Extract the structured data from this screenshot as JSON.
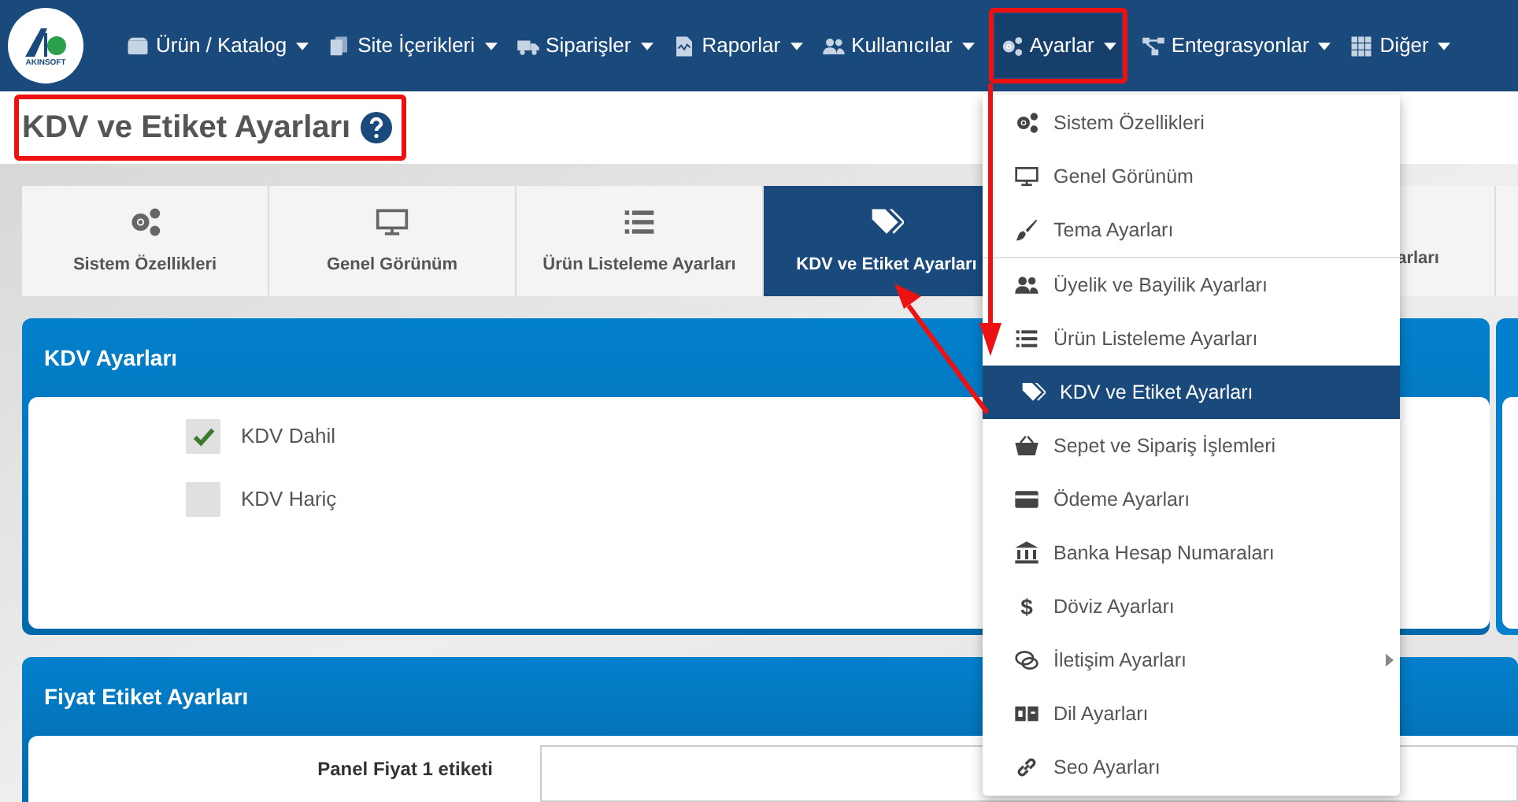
{
  "logo": {
    "text": "AKINSOFT"
  },
  "nav": [
    {
      "label": "Ürün / Katalog",
      "selected": false
    },
    {
      "label": "Site İçerikleri",
      "selected": false
    },
    {
      "label": "Siparişler",
      "selected": false
    },
    {
      "label": "Raporlar",
      "selected": false
    },
    {
      "label": "Kullanıcılar",
      "selected": false
    },
    {
      "label": "Ayarlar",
      "selected": true
    },
    {
      "label": "Entegrasyonlar",
      "selected": false
    },
    {
      "label": "Diğer",
      "selected": false
    }
  ],
  "page_title": "KDV ve Etiket Ayarları",
  "tabs": [
    {
      "label": "Sistem Özellikleri",
      "selected": false
    },
    {
      "label": "Genel Görünüm",
      "selected": false
    },
    {
      "label": "Ürün Listeleme Ayarları",
      "selected": false
    },
    {
      "label": "KDV ve Etiket Ayarları",
      "selected": true
    },
    {
      "label": "arları",
      "selected": false
    }
  ],
  "kdv_panel": {
    "title": "KDV Ayarları",
    "options": [
      {
        "label": "KDV Dahil",
        "checked": true
      },
      {
        "label": "KDV Hariç",
        "checked": false
      }
    ]
  },
  "price_panel": {
    "title": "Fiyat Etiket Ayarları",
    "fields": [
      {
        "label": "Panel Fiyat 1 etiketi"
      }
    ]
  },
  "menu": {
    "items": [
      {
        "label": "Sistem Özellikleri",
        "selected": false
      },
      {
        "label": "Genel Görünüm",
        "selected": false
      },
      {
        "label": "Tema Ayarları",
        "selected": false
      },
      {
        "label": "Üyelik ve Bayilik Ayarları",
        "selected": false
      },
      {
        "label": "Ürün Listeleme Ayarları",
        "selected": false
      },
      {
        "label": "KDV ve Etiket Ayarları",
        "selected": true
      },
      {
        "label": "Sepet ve Sipariş İşlemleri",
        "selected": false
      },
      {
        "label": "Ödeme Ayarları",
        "selected": false
      },
      {
        "label": "Banka Hesap Numaraları",
        "selected": false
      },
      {
        "label": "Döviz Ayarları",
        "glyph": "$",
        "selected": false
      },
      {
        "label": "İletişim Ayarları",
        "selected": false,
        "has_submenu": true
      },
      {
        "label": "Dil Ayarları",
        "selected": false
      },
      {
        "label": "Seo Ayarları",
        "selected": false
      }
    ]
  }
}
